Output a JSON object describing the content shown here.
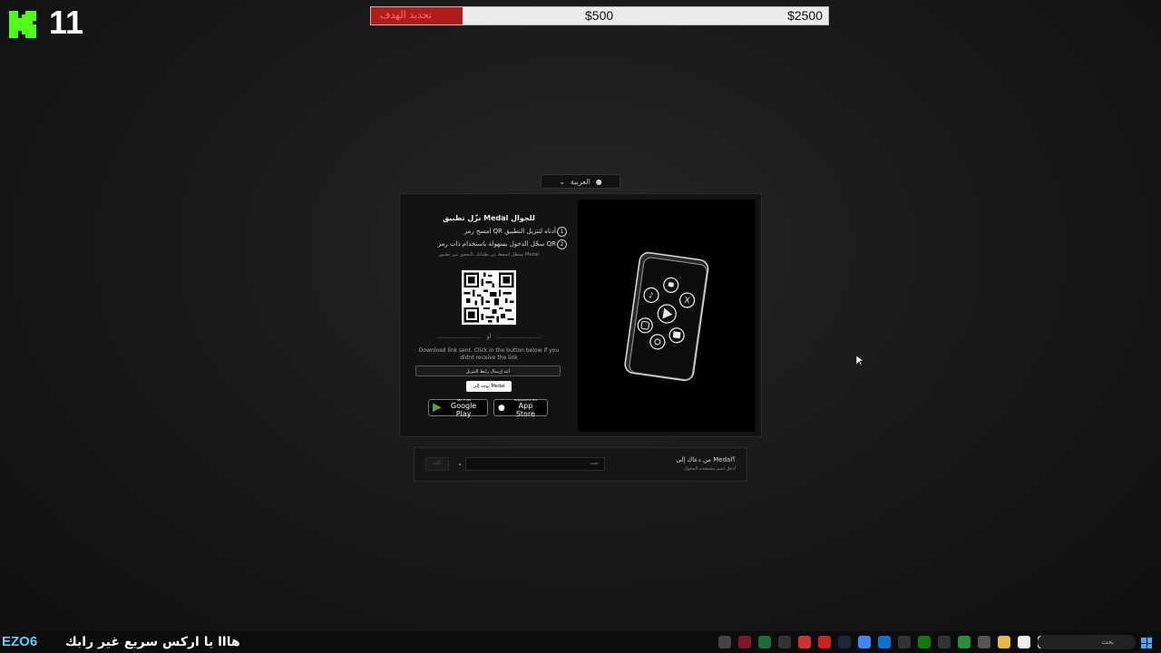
{
  "overlay": {
    "kick_count": "11",
    "goal": {
      "label": "تحديد الهدف",
      "current": "$500",
      "target": "$2500",
      "progress_fraction": 0.2
    }
  },
  "language_selector": {
    "label": "العربية"
  },
  "medal_card": {
    "title": "نزّل تطبيق Medal للجوال",
    "steps": [
      {
        "num": "1",
        "text": "امسح رمز QR أدناه لتنزيل التطبيق"
      },
      {
        "num": "2",
        "text": "سجّل الدخول بسهولة باستخدام ذات رمز QR"
      }
    ],
    "hint": "ستظل لتحفظ عن طلباتك بالتحقق عبر تطبيق Medal",
    "or_text": "أو",
    "download_message": "Download link sent. Click in the button below if you didnt receive the link",
    "resend_button": "أعد إرسال رابط التنزيل",
    "go_button": "توجه إلى Medal",
    "google_play": {
      "small": "GET IT ON",
      "big": "Google Play"
    },
    "app_store": {
      "small": "Download on the",
      "big": "App Store"
    }
  },
  "referral": {
    "title": "من دعاك إلى Medal؟",
    "subtitle": "أدخل اسم مستخدم المحول",
    "input_placeholder": "بحث",
    "submit_label": "تأكيد"
  },
  "taskbar": {
    "chat_name": "EZO6",
    "chat_message": "هااا يا اركس سريع غير رابك",
    "search_label": "بحث"
  }
}
